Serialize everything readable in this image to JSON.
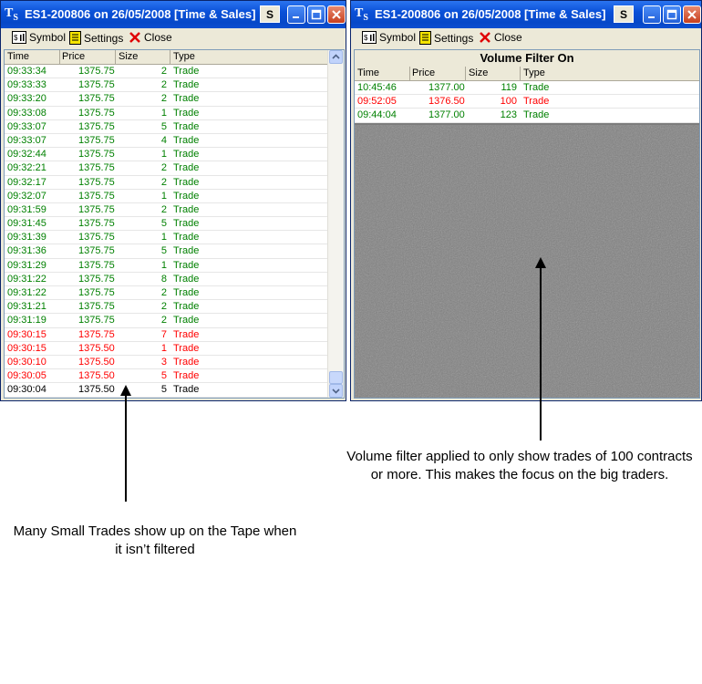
{
  "left_window": {
    "title": "ES1-200806 on 26/05/2008   [Time & Sales]",
    "s_button": "S",
    "toolbar": {
      "symbol": "Symbol",
      "settings": "Settings",
      "close": "Close"
    },
    "columns": [
      "Time",
      "Price",
      "Size",
      "Type"
    ],
    "rows": [
      [
        "09:33:34",
        "1375.75",
        "2",
        "Trade",
        "green"
      ],
      [
        "09:33:33",
        "1375.75",
        "2",
        "Trade",
        "green"
      ],
      [
        "09:33:20",
        "1375.75",
        "2",
        "Trade",
        "green"
      ],
      [
        "09:33:08",
        "1375.75",
        "1",
        "Trade",
        "green"
      ],
      [
        "09:33:07",
        "1375.75",
        "5",
        "Trade",
        "green"
      ],
      [
        "09:33:07",
        "1375.75",
        "4",
        "Trade",
        "green"
      ],
      [
        "09:32:44",
        "1375.75",
        "1",
        "Trade",
        "green"
      ],
      [
        "09:32:21",
        "1375.75",
        "2",
        "Trade",
        "green"
      ],
      [
        "09:32:17",
        "1375.75",
        "2",
        "Trade",
        "green"
      ],
      [
        "09:32:07",
        "1375.75",
        "1",
        "Trade",
        "green"
      ],
      [
        "09:31:59",
        "1375.75",
        "2",
        "Trade",
        "green"
      ],
      [
        "09:31:45",
        "1375.75",
        "5",
        "Trade",
        "green"
      ],
      [
        "09:31:39",
        "1375.75",
        "1",
        "Trade",
        "green"
      ],
      [
        "09:31:36",
        "1375.75",
        "5",
        "Trade",
        "green"
      ],
      [
        "09:31:29",
        "1375.75",
        "1",
        "Trade",
        "green"
      ],
      [
        "09:31:22",
        "1375.75",
        "8",
        "Trade",
        "green"
      ],
      [
        "09:31:22",
        "1375.75",
        "2",
        "Trade",
        "green"
      ],
      [
        "09:31:21",
        "1375.75",
        "2",
        "Trade",
        "green"
      ],
      [
        "09:31:19",
        "1375.75",
        "2",
        "Trade",
        "green"
      ],
      [
        "09:30:15",
        "1375.75",
        "7",
        "Trade",
        "red"
      ],
      [
        "09:30:15",
        "1375.50",
        "1",
        "Trade",
        "red"
      ],
      [
        "09:30:10",
        "1375.50",
        "3",
        "Trade",
        "red"
      ],
      [
        "09:30:05",
        "1375.50",
        "5",
        "Trade",
        "red"
      ],
      [
        "09:30:04",
        "1375.50",
        "5",
        "Trade",
        "black"
      ]
    ]
  },
  "right_window": {
    "title": "ES1-200806 on 26/05/2008   [Time & Sales]",
    "s_button": "S",
    "toolbar": {
      "symbol": "Symbol",
      "settings": "Settings",
      "close": "Close"
    },
    "filter_label": "Volume Filter On",
    "columns": [
      "Time",
      "Price",
      "Size",
      "Type"
    ],
    "rows": [
      [
        "10:45:46",
        "1377.00",
        "119",
        "Trade",
        "green"
      ],
      [
        "09:52:05",
        "1376.50",
        "100",
        "Trade",
        "red"
      ],
      [
        "09:44:04",
        "1377.00",
        "123",
        "Trade",
        "green"
      ]
    ]
  },
  "captions": {
    "left": "Many Small Trades show up on the Tape when it isn’t filtered",
    "right": "Volume filter applied to only show trades of 100 contracts or more. This makes the focus on the big traders."
  },
  "colors": {
    "buy": "#008000",
    "sell": "#ff0000",
    "neutral": "#000000",
    "titlebar": "#0a50d8"
  }
}
